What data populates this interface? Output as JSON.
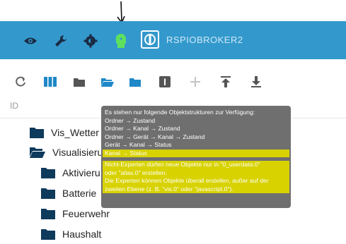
{
  "header": {
    "app_name": "RSPIOBROKER2",
    "icons": [
      "eye-icon",
      "wrench-icon",
      "gear-icon",
      "expert-head-icon",
      "iobroker-logo"
    ]
  },
  "toolbar": {
    "buttons": [
      "refresh-icon",
      "columns-icon",
      "folder-icon",
      "folder-open-icon",
      "folder-closed-icon",
      "number-one-icon",
      "add-icon",
      "upload-icon",
      "download-icon"
    ]
  },
  "table": {
    "column_id": "ID"
  },
  "tree": [
    {
      "label": "Vis_Wetter",
      "level": 1,
      "open": false
    },
    {
      "label": "Visualisieru",
      "level": 1,
      "open": true
    },
    {
      "label": "Aktivieru",
      "level": 2,
      "open": false
    },
    {
      "label": "Batterie",
      "level": 2,
      "open": false
    },
    {
      "label": "Feuerwehr",
      "level": 2,
      "open": false
    },
    {
      "label": "Haushalt",
      "level": 2,
      "open": false
    }
  ],
  "tooltip": {
    "intro": "Es stehen nur folgende Objektstrukturen zur Verfügung:",
    "line1": "Ordner → Zustand",
    "line2": "Ordner → Kanal → Zustand",
    "line3": "Ordner → Gerät → Kanal → Zustand",
    "line4": "Gerät → Kanal → Status",
    "line5": "Kanal → Status",
    "note1a": "Nicht-Experten dürfen neue Objekte nur in \"0_userdata.0\"",
    "note1b": "oder \"alias.0\" erstellen.",
    "note2a": "Die Experten können Objekte überall erstellen, außer auf der",
    "note2b": "zweiten Ebene (z. B. \"vis.0\" oder \"javascript.0\")."
  },
  "colors": {
    "header_bg": "#3399cc",
    "expert_icon": "#5ee05e",
    "folder": "#0e3a5c",
    "toolbar_icon": "#1e88c8",
    "tooltip_bg": "#6f6f6f",
    "highlight": "#d8d200"
  }
}
